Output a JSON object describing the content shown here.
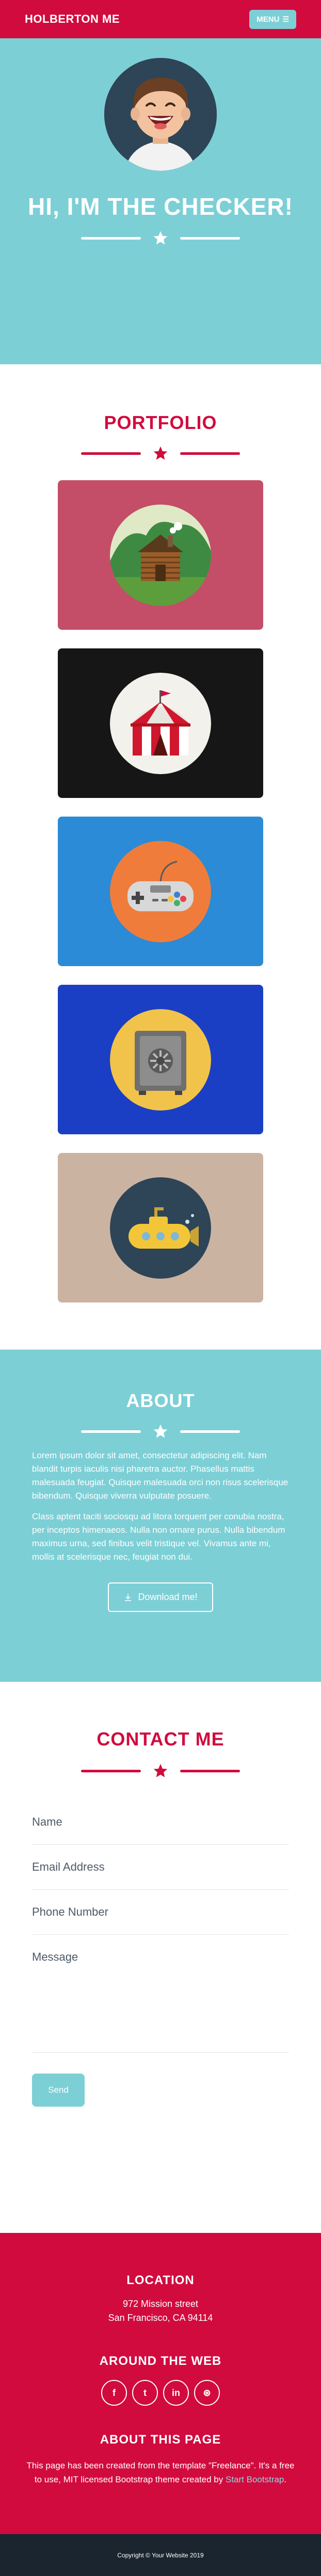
{
  "navbar": {
    "brand": "HOLBERTON ME",
    "menu_label": "MENU",
    "menu_icon": "bars-icon"
  },
  "masthead": {
    "title": "HI, I'M THE CHECKER!",
    "divider_icon": "star-icon"
  },
  "portfolio": {
    "title": "PORTFOLIO",
    "items": [
      {
        "name": "cabin",
        "bg": "#c44e67"
      },
      {
        "name": "circus",
        "bg": "#161616"
      },
      {
        "name": "game-controller",
        "bg": "#2b8bd6"
      },
      {
        "name": "safe",
        "bg": "#1b3fc4"
      },
      {
        "name": "submarine",
        "bg": "#cbb3a2"
      }
    ]
  },
  "about": {
    "title": "ABOUT",
    "paragraph_1": "Lorem ipsum dolor sit amet, consectetur adipiscing elit. Nam blandit turpis iaculis nisi pharetra auctor. Phasellus mattis malesuada feugiat. Quisque malesuada orci non risus scelerisque bibendum. Quisque viverra vulputate posuere.",
    "paragraph_2": "Class aptent taciti sociosqu ad litora torquent per conubia nostra, per inceptos himenaeos. Nulla non ornare purus. Nulla bibendum maximus urna, sed finibus velit tristique vel. Vivamus ante mi, mollis at scelerisque nec, feugiat non dui.",
    "download_label": "Download me!"
  },
  "contact": {
    "title": "CONTACT ME",
    "fields": {
      "name": "Name",
      "email": "Email Address",
      "phone": "Phone Number",
      "message": "Message"
    },
    "send_label": "Send"
  },
  "footer": {
    "location_title": "LOCATION",
    "address_line1": "972 Mission street",
    "address_line2": "San Francisco, CA 94114",
    "around_title": "AROUND THE WEB",
    "socials": [
      {
        "icon": "facebook-icon",
        "glyph": "f"
      },
      {
        "icon": "twitter-icon",
        "glyph": "t"
      },
      {
        "icon": "linkedin-icon",
        "glyph": "in"
      },
      {
        "icon": "dribbble-icon",
        "glyph": "⊛"
      }
    ],
    "about_title": "ABOUT THIS PAGE",
    "about_text_1": "This page has been created from the template \"Freelance\". It's a free to use, MIT licensed Bootstrap theme created by",
    "about_link": "Start Bootstrap",
    "about_text_end": "."
  },
  "copyright": "Copyright © Your Website 2019",
  "colors": {
    "primary": "#d10b3e",
    "teal": "#7dcfd6",
    "dark": "#1a252f"
  }
}
